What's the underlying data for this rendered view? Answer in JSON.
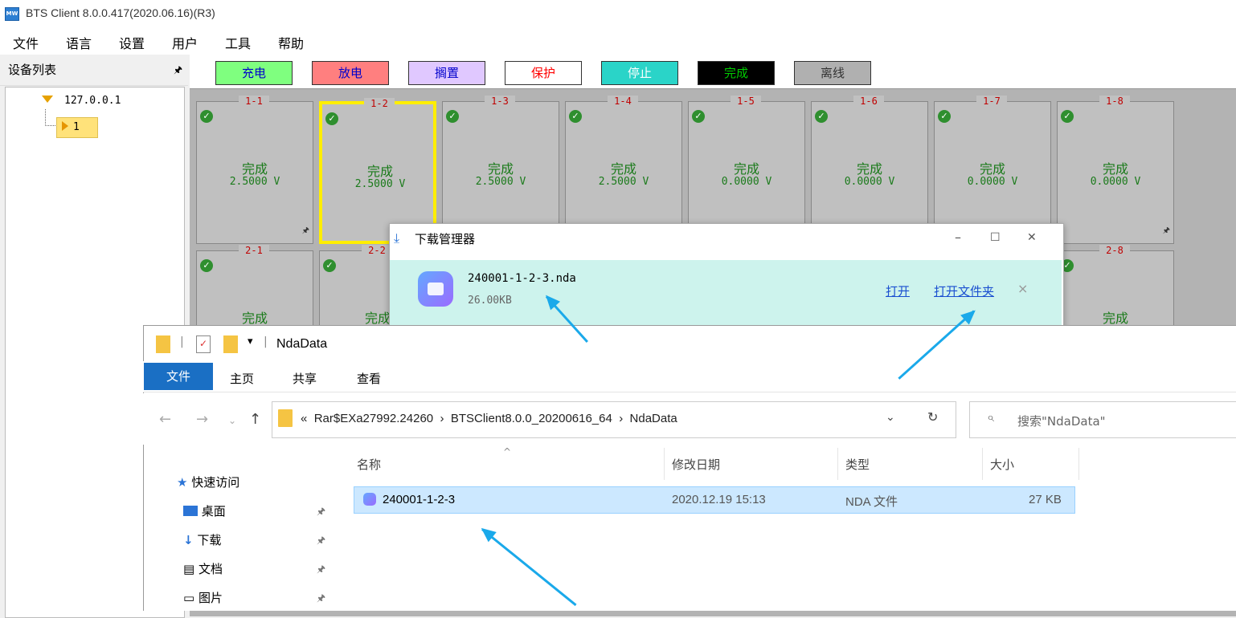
{
  "window": {
    "title": "BTS Client 8.0.0.417(2020.06.16)(R3)",
    "icon": "app-icon"
  },
  "menu": [
    "文件",
    "语言",
    "设置",
    "用户",
    "工具",
    "帮助"
  ],
  "left_panel": {
    "title": "设备列表",
    "ip": "127.0.0.1",
    "node": "1"
  },
  "legend": [
    {
      "label": "充电",
      "bg": "#7fff7f",
      "fg": "#0000cc"
    },
    {
      "label": "放电",
      "bg": "#ff7f7f",
      "fg": "#0000cc"
    },
    {
      "label": "搁置",
      "bg": "#e0c8ff",
      "fg": "#0000cc"
    },
    {
      "label": "保护",
      "bg": "#ffffff",
      "fg": "#ff0000"
    },
    {
      "label": "停止",
      "bg": "#2ad4c8",
      "fg": "#ffffff"
    },
    {
      "label": "完成",
      "bg": "#000000",
      "fg": "#00cc00"
    },
    {
      "label": "离线",
      "bg": "#b0b0b0",
      "fg": "#333333"
    }
  ],
  "channels_row1": [
    {
      "id": "1-1",
      "status": "完成",
      "voltage": "2.5000 V"
    },
    {
      "id": "1-2",
      "status": "完成",
      "voltage": "2.5000 V"
    },
    {
      "id": "1-3",
      "status": "完成",
      "voltage": "2.5000 V"
    },
    {
      "id": "1-4",
      "status": "完成",
      "voltage": "2.5000 V"
    },
    {
      "id": "1-5",
      "status": "完成",
      "voltage": "0.0000 V"
    },
    {
      "id": "1-6",
      "status": "完成",
      "voltage": "0.0000 V"
    },
    {
      "id": "1-7",
      "status": "完成",
      "voltage": "0.0000 V"
    },
    {
      "id": "1-8",
      "status": "完成",
      "voltage": "0.0000 V"
    }
  ],
  "channels_row2": [
    {
      "id": "2-1",
      "status": "完成"
    },
    {
      "id": "2-2",
      "status": "完成"
    },
    {
      "id": "2-8",
      "status": "完成"
    }
  ],
  "download_manager": {
    "title": "下载管理器",
    "filename": "240001-1-2-3.nda",
    "size": "26.00KB",
    "open": "打开",
    "open_folder": "打开文件夹",
    "remove": "×",
    "minimize": "–",
    "maximize": "☐",
    "close": "✕"
  },
  "explorer": {
    "title": "NdaData",
    "tabs": {
      "file": "文件",
      "home": "主页",
      "share": "共享",
      "view": "查看"
    },
    "path": {
      "prefix": "«",
      "seg1": "Rar$EXa27992.24260",
      "sep": "›",
      "seg2": "BTSClient8.0.0_20200616_64",
      "seg3": "NdaData"
    },
    "search_placeholder": "搜索\"NdaData\"",
    "nav": {
      "quick_access": "快速访问",
      "desktop": "桌面",
      "downloads": "下载",
      "documents": "文档",
      "pictures": "图片"
    },
    "columns": {
      "name": "名称",
      "modified": "修改日期",
      "type": "类型",
      "size": "大小"
    },
    "file": {
      "name": "240001-1-2-3",
      "modified": "2020.12.19 15:13",
      "type": "NDA 文件",
      "size": "27 KB"
    }
  },
  "icons": {
    "pin": "pin-icon",
    "check": "check-icon",
    "arrow": "annotation-arrow",
    "highlight_color": "#ffee00",
    "arrow_color": "#1aa9ea"
  }
}
